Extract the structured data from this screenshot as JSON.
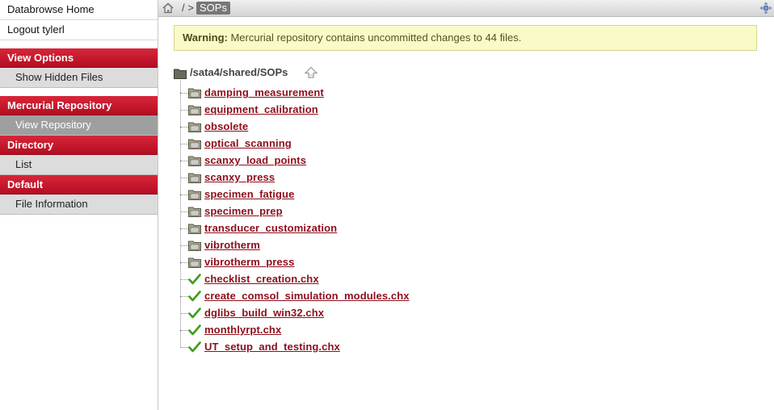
{
  "sidebar": {
    "top_links": [
      "Databrowse Home",
      "Logout tylerl"
    ],
    "sections": [
      {
        "title": "View Options",
        "items": [
          {
            "label": "Show Hidden Files",
            "active": false
          }
        ]
      },
      {
        "title": "Mercurial Repository",
        "items": [
          {
            "label": "View Repository",
            "active": true
          }
        ]
      },
      {
        "title": "Directory",
        "items": [
          {
            "label": "List",
            "active": false
          }
        ]
      },
      {
        "title": "Default",
        "items": [
          {
            "label": "File Information",
            "active": false
          }
        ]
      }
    ]
  },
  "breadcrumb": {
    "separator": "/ >",
    "current": "SOPs"
  },
  "warning": {
    "label": "Warning:",
    "message": "Mercurial repository contains uncommitted changes to 44 files."
  },
  "tree": {
    "root_path": "/sata4/shared/SOPs",
    "folders": [
      "damping_measurement",
      "equipment_calibration",
      "obsolete",
      "optical_scanning",
      "scanxy_load_points",
      "scanxy_press",
      "specimen_fatigue",
      "specimen_prep",
      "transducer_customization",
      "vibrotherm",
      "vibrotherm_press"
    ],
    "files": [
      "checklist_creation.chx",
      "create_comsol_simulation_modules.chx",
      "dglibs_build_win32.chx",
      "monthlyrpt.chx",
      "UT_setup_and_testing.chx"
    ]
  },
  "colors": {
    "accent_red": "#c01a2e",
    "link_red": "#8c0f1c",
    "warning_bg": "#fafac9",
    "check_green": "#3aa014"
  },
  "icons": {
    "folder": "folder-icon",
    "file_status": "check-icon",
    "home": "home-icon",
    "up": "up-directory-icon",
    "expand": "expand-icon"
  }
}
